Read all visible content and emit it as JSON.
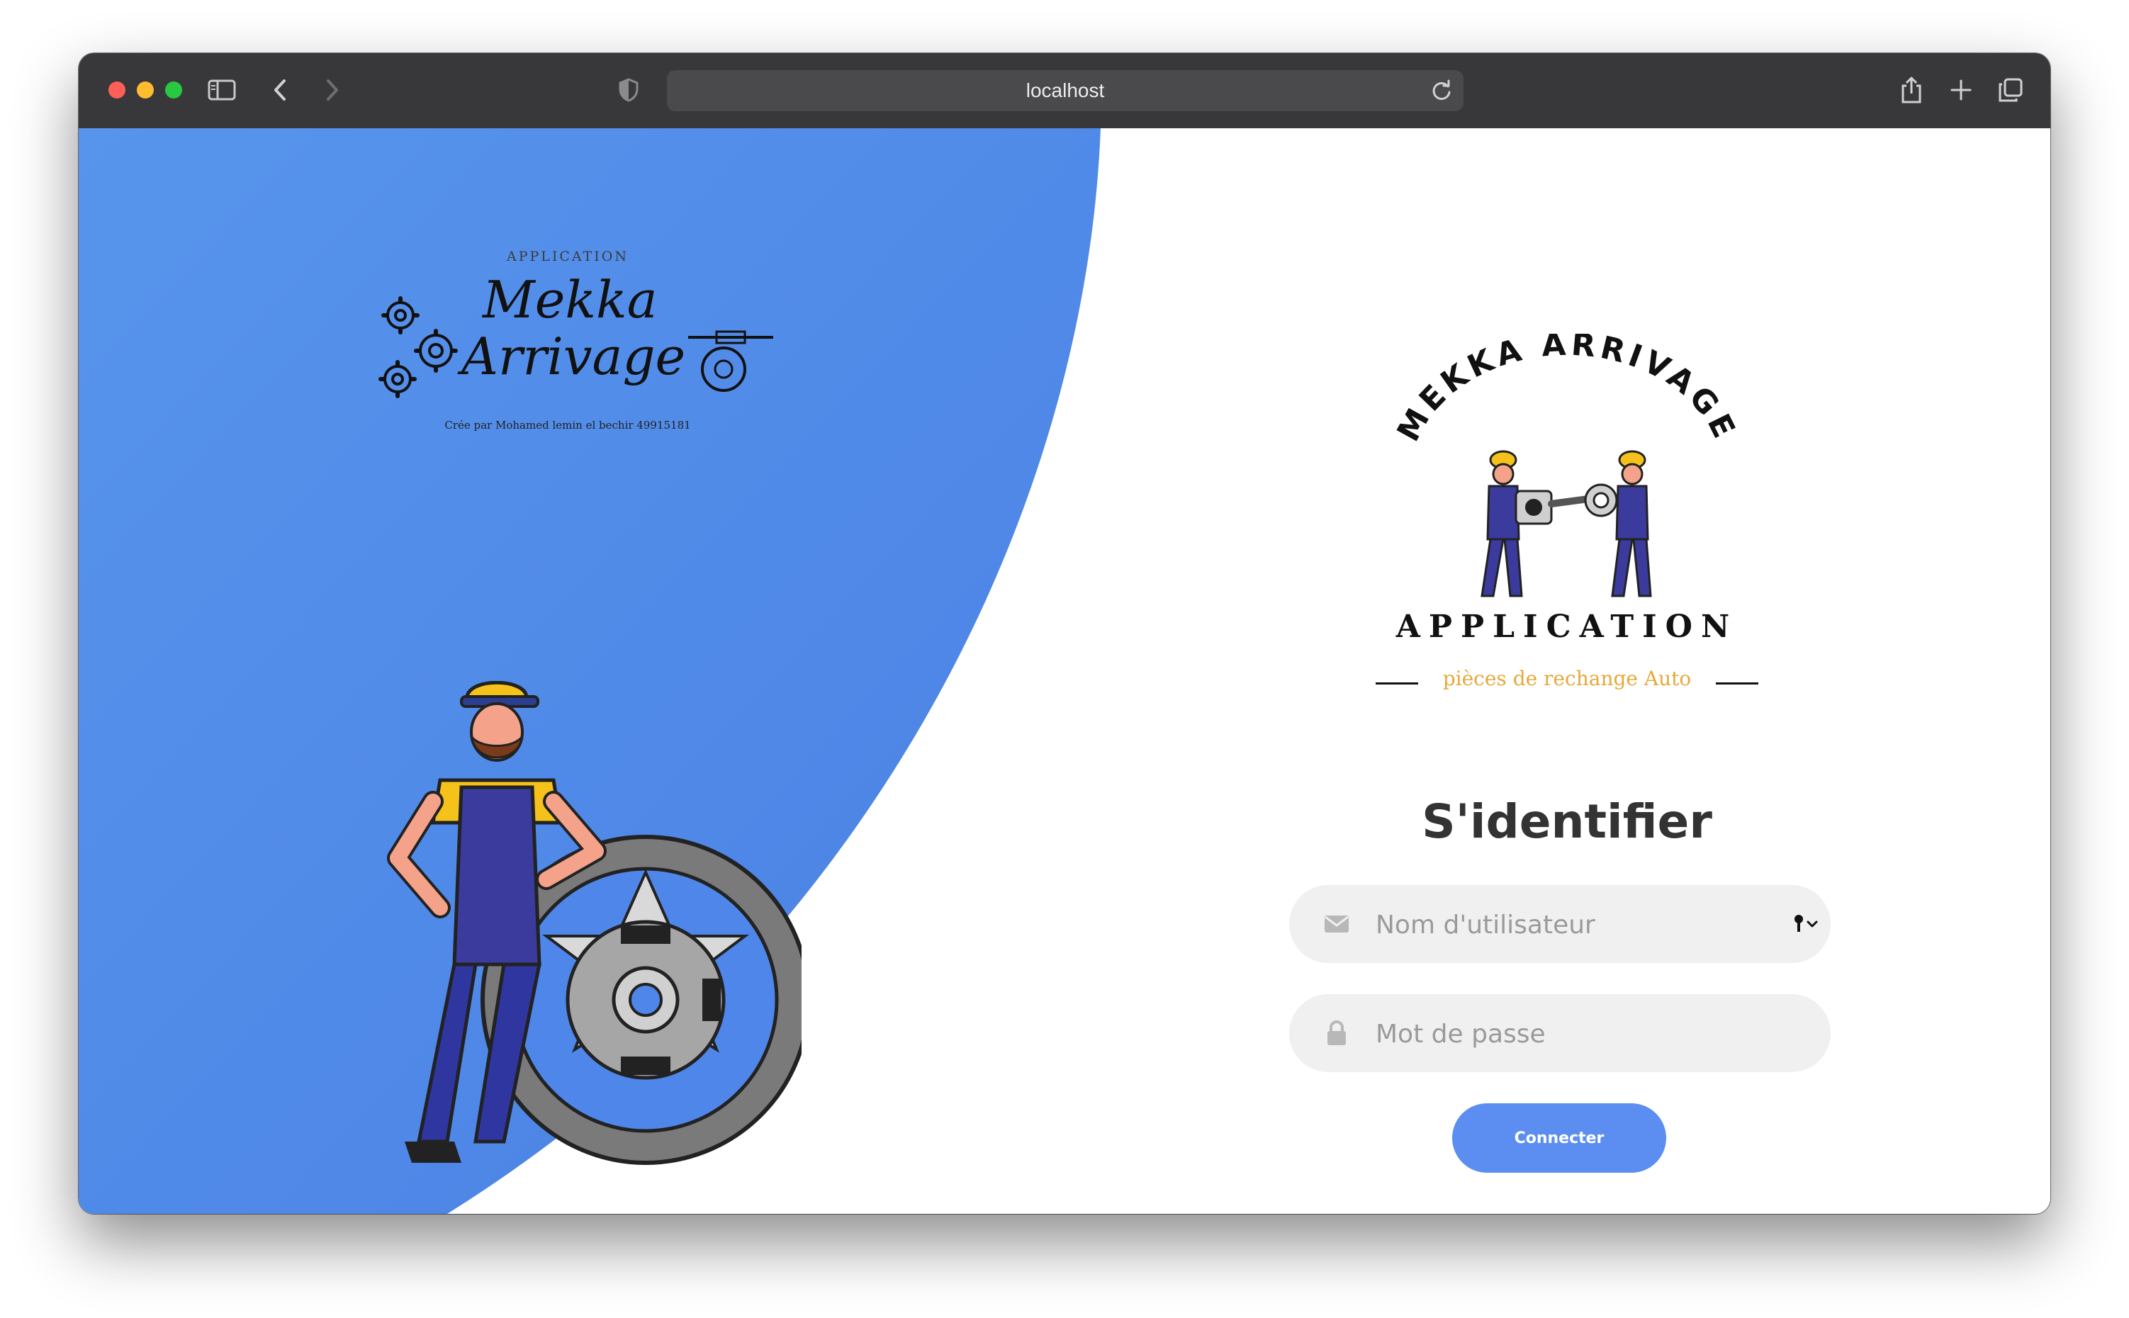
{
  "browser": {
    "url": "localhost"
  },
  "left_logo": {
    "label": "APPLICATION",
    "brand_line1": "Mekka",
    "brand_line2": "Arrivage",
    "credit": "Crée par Mohamed lemin el bechir 49915181"
  },
  "right_logo": {
    "arc_text": "MEKKA ARRIVAGE",
    "title": "APPLICATION",
    "subtitle": "pièces de rechange Auto"
  },
  "login": {
    "title": "S'identifier",
    "username_placeholder": "Nom d'utilisateur",
    "password_placeholder": "Mot de passe",
    "submit_label": "Connecter"
  },
  "colors": {
    "blue_panel": "#4f86ea",
    "button": "#5b8ef0",
    "subtitle_gold": "#e6a93a"
  }
}
